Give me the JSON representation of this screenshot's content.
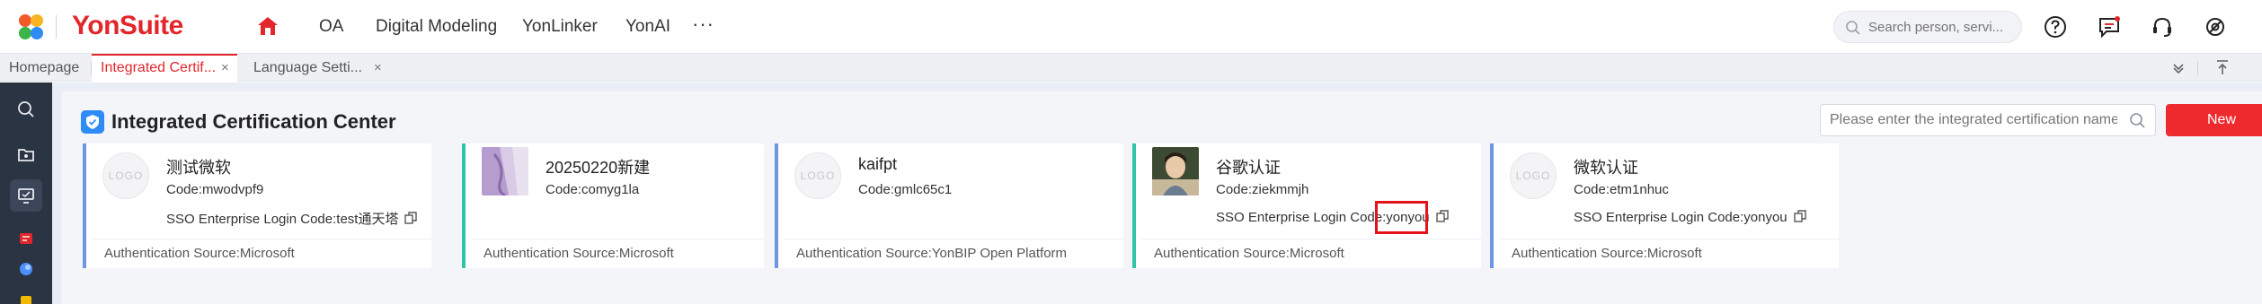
{
  "header": {
    "logo_text": "YonSuite",
    "nav": [
      "OA",
      "Digital Modeling",
      "YonLinker",
      "YonAI"
    ],
    "more": "···",
    "search_placeholder": "Search person, servi...",
    "icons": [
      "help-icon",
      "message-icon",
      "headset-icon",
      "settings-icon"
    ]
  },
  "tabs": {
    "items": [
      {
        "label": "Homepage",
        "closable": false
      },
      {
        "label": "Integrated Certif...",
        "closable": true,
        "active": true
      },
      {
        "label": "Language Setti...",
        "closable": true
      }
    ],
    "close_glyph": "×"
  },
  "panel": {
    "title": "Integrated Certification Center",
    "filter_placeholder": "Please enter the integrated certification name",
    "new_label": "New"
  },
  "cards": [
    {
      "name": "测试微软",
      "code": "Code:mwodvpf9",
      "sso": "SSO Enterprise Login Code:test通天塔",
      "source": "Authentication Source:Microsoft",
      "avatar": "LOGO",
      "accent": "#6f95e6"
    },
    {
      "name": "20250220新建",
      "code": "Code:comyg1la",
      "sso": "",
      "source": "Authentication Source:Microsoft",
      "avatar": "image",
      "accent": "#2fc6a8"
    },
    {
      "name": "kaifpt",
      "code": "Code:gmlc65c1",
      "sso": "",
      "source": "Authentication Source:YonBIP Open Platform",
      "avatar": "LOGO",
      "accent": "#6f95e6"
    },
    {
      "name": "谷歌认证",
      "code": "Code:ziekmmjh",
      "sso": "SSO Enterprise Login Code:yonyou",
      "source": "Authentication Source:Microsoft",
      "avatar": "image",
      "accent": "#2fc6a8"
    },
    {
      "name": "微软认证",
      "code": "Code:etm1nhuc",
      "sso": "SSO Enterprise Login Code:yonyou",
      "source": "Authentication Source:Microsoft",
      "avatar": "LOGO",
      "accent": "#6f95e6"
    }
  ],
  "colors": {
    "brand": "#e3262c",
    "accent_blue": "#6f95e6",
    "accent_teal": "#2fc6a8",
    "highlight": "#e3121b"
  }
}
